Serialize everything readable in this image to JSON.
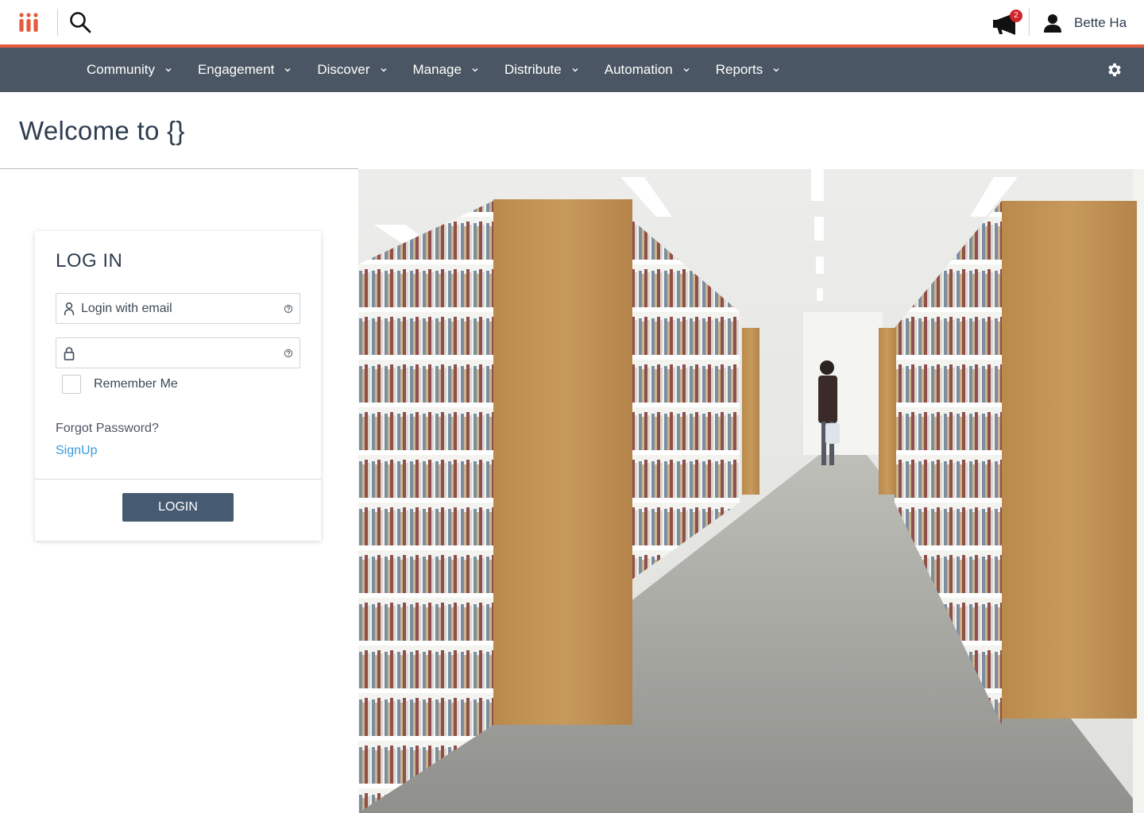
{
  "topbar": {
    "logo_icon": "iii-logo-icon",
    "search_icon": "search-icon",
    "announcement_icon": "megaphone-icon",
    "notification_count": "2",
    "user_icon": "person-icon",
    "user_name": "Bette Ha"
  },
  "nav": {
    "items": [
      {
        "label": "Community"
      },
      {
        "label": "Engagement"
      },
      {
        "label": "Discover"
      },
      {
        "label": "Manage"
      },
      {
        "label": "Distribute"
      },
      {
        "label": "Automation"
      },
      {
        "label": "Reports"
      }
    ],
    "settings_icon": "gear-icon"
  },
  "page": {
    "title": "Welcome to {}"
  },
  "login": {
    "heading": "LOG IN",
    "email_placeholder": "Login with email",
    "email_value": "",
    "password_placeholder": "",
    "password_value": "",
    "remember_label": "Remember Me",
    "forgot_label": "Forgot Password?",
    "signup_label": "SignUp",
    "submit_label": "LOGIN"
  },
  "colors": {
    "accent_orange": "#e55a3c",
    "nav_bg": "#4a5663",
    "button_bg": "#465a72",
    "link_blue": "#3a9ad9",
    "badge_red": "#d0232a"
  }
}
